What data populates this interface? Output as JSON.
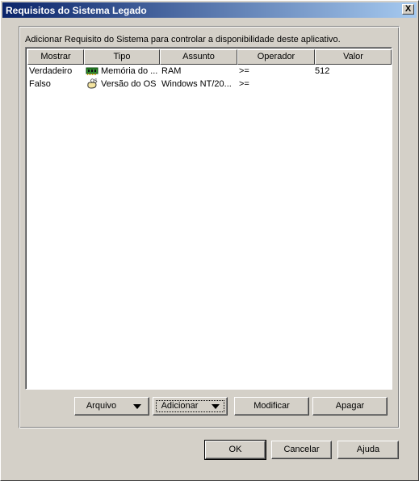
{
  "window": {
    "title": "Requisitos do Sistema Legado",
    "close_label": "X"
  },
  "description": "Adicionar Requisito do Sistema para controlar a disponibilidade deste aplicativo.",
  "table": {
    "columns": [
      "Mostrar",
      "Tipo",
      "Assunto",
      "Operador",
      "Valor"
    ],
    "rows": [
      {
        "mostrar": "Verdadeiro",
        "tipo": "Memória do ...",
        "tipo_icon": "memory-chip-icon",
        "assunto": "RAM",
        "operador": ">=",
        "valor": "512"
      },
      {
        "mostrar": "Falso",
        "tipo": "Versão do OS",
        "tipo_icon": "os-version-icon",
        "assunto": "Windows NT/20...",
        "operador": ">=",
        "valor": ""
      }
    ]
  },
  "list_buttons": {
    "arquivo": "Arquivo",
    "adicionar": "Adicionar",
    "modificar": "Modificar",
    "apagar": "Apagar"
  },
  "dialog_buttons": {
    "ok": "OK",
    "cancelar": "Cancelar",
    "ajuda": "Ajuda"
  }
}
